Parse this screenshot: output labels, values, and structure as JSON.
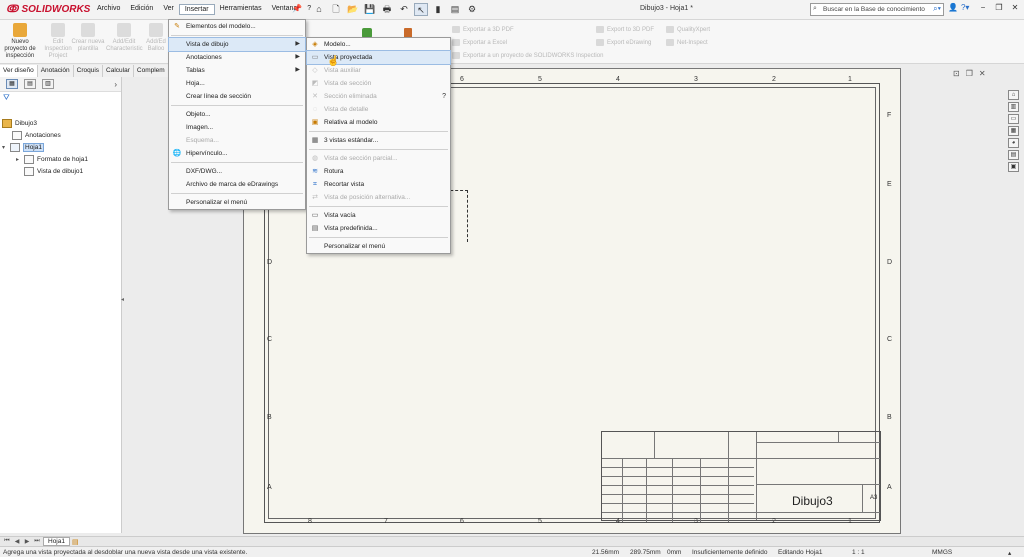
{
  "app": {
    "logo_text": "SOLIDWORKS",
    "document_title": "Dibujo3 - Hoja1 *"
  },
  "menubar": [
    "Archivo",
    "Edición",
    "Ver",
    "Insertar",
    "Herramientas",
    "Ventana",
    "?"
  ],
  "search": {
    "placeholder": "Buscar en la Base de conocimiento"
  },
  "ribbon": {
    "buttons": [
      {
        "label": "Nuevo proyecto de inspección",
        "enabled": true
      },
      {
        "label": "Edit Inspection Project",
        "enabled": false
      },
      {
        "label": "Crear nueva plantilla",
        "enabled": false
      },
      {
        "label": "Add/Edit Characteristic",
        "enabled": false
      },
      {
        "label": "Add/Ed Balloo",
        "enabled": false
      }
    ],
    "small_items": [
      "Exportar a 3D PDF",
      "Exportar a Excel",
      "Exportar a un proyecto de SOLIDWORKS Inspection",
      "Export to 3D PDF",
      "Export eDrawing",
      "QualityXpert",
      "Net-Inspect"
    ]
  },
  "tabs": [
    "Ver diseño",
    "Anotación",
    "Croquis",
    "Calcular",
    "Complem"
  ],
  "tree": {
    "root": "Dibujo3",
    "items": [
      {
        "label": "Anotaciones",
        "level": 1
      },
      {
        "label": "Hoja1",
        "level": 1,
        "selected": true
      },
      {
        "label": "Formato de hoja1",
        "level": 2
      },
      {
        "label": "Vista de dibujo1",
        "level": 2
      }
    ]
  },
  "insert_menu": {
    "items": [
      {
        "label": "Elementos del modelo...",
        "enabled": true
      },
      {
        "label": "Vista de dibujo",
        "enabled": true,
        "submenu": true,
        "highlight": true
      },
      {
        "label": "Anotaciones",
        "enabled": true,
        "submenu": true
      },
      {
        "label": "Tablas",
        "enabled": true,
        "submenu": true
      },
      {
        "label": "Hoja...",
        "enabled": true
      },
      {
        "label": "Crear línea de sección",
        "enabled": true
      },
      {
        "label": "Objeto...",
        "enabled": true
      },
      {
        "label": "Imagen...",
        "enabled": true
      },
      {
        "label": "Esquema...",
        "enabled": false
      },
      {
        "label": "Hipervínculo...",
        "enabled": true
      },
      {
        "label": "DXF/DWG...",
        "enabled": true
      },
      {
        "label": "Archivo de marca de eDrawings",
        "enabled": true
      },
      {
        "label": "Personalizar el menú",
        "enabled": true
      }
    ]
  },
  "view_submenu": {
    "items": [
      {
        "label": "Modelo...",
        "enabled": true
      },
      {
        "label": "Vista proyectada",
        "enabled": true,
        "highlight": true
      },
      {
        "label": "Vista auxiliar",
        "enabled": false
      },
      {
        "label": "Vista de sección",
        "enabled": false
      },
      {
        "label": "Sección eliminada",
        "enabled": false
      },
      {
        "label": "Vista de detalle",
        "enabled": false
      },
      {
        "label": "Relativa al modelo",
        "enabled": true
      },
      {
        "label": "3 vistas estándar...",
        "enabled": true
      },
      {
        "label": "Vista de sección parcial...",
        "enabled": false
      },
      {
        "label": "Rotura",
        "enabled": true
      },
      {
        "label": "Recortar vista",
        "enabled": true
      },
      {
        "label": "Vista de posición alternativa...",
        "enabled": false
      },
      {
        "label": "Vista vacía",
        "enabled": true
      },
      {
        "label": "Vista predefinida...",
        "enabled": true
      },
      {
        "label": "Personalizar el menú",
        "enabled": true
      }
    ]
  },
  "sheet": {
    "top_zones": [
      "6",
      "5",
      "4",
      "3",
      "2",
      "1"
    ],
    "bottom_zones": [
      "8",
      "7",
      "6",
      "5",
      "4",
      "3",
      "2",
      "1"
    ],
    "right_zones": [
      "F",
      "E",
      "D",
      "C",
      "B",
      "A"
    ],
    "left_zones": [
      "D",
      "C",
      "B",
      "A"
    ],
    "drawing_name": "Dibujo3",
    "sheet_size": "A3"
  },
  "sheet_tab": "Hoja1",
  "status": {
    "message": "Agrega una vista proyectada al desdoblar una nueva vista desde una vista existente.",
    "x": "21.56mm",
    "y": "289.75mm",
    "z": "0mm",
    "state": "Insuficientemente definido",
    "mode": "Editando Hoja1",
    "scale": "1 : 1",
    "units": "MMGS"
  }
}
